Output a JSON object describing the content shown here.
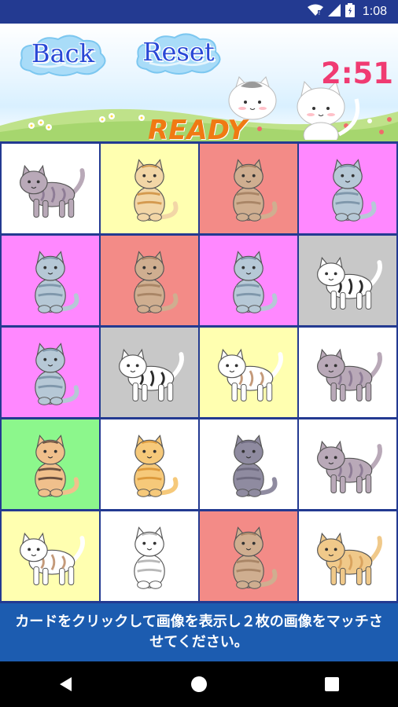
{
  "status_bar": {
    "time": "1:08",
    "icons": [
      "wifi-icon",
      "signal-icon",
      "battery-icon"
    ]
  },
  "header": {
    "back_label": "Back",
    "reset_label": "Reset",
    "timer": "2:51",
    "status": "READY"
  },
  "colors": {
    "status_bar": "#233a91",
    "grid_border": "#233a91",
    "button_text": "#2948d6",
    "timer": "#f03b72",
    "ready": "#f07a13",
    "instruction_bg": "#1c5cb0",
    "card_white": "#ffffff",
    "card_yellow": "#ffffb0",
    "card_salmon": "#f38b87",
    "card_magenta": "#ff88ff",
    "card_gray": "#c8c8c8",
    "card_green": "#8cf78c"
  },
  "cards": [
    {
      "bg": "#ffffff",
      "cat": "gray-tabby-standing-cat",
      "body": "#b9a9b8",
      "stripe": "#8e7c96"
    },
    {
      "bg": "#ffffb0",
      "cat": "orange-longhair-sitting-cat",
      "body": "#f2d6a6",
      "stripe": "#d49a4f"
    },
    {
      "bg": "#f38b87",
      "cat": "tan-sitting-cat",
      "body": "#cfae90",
      "stripe": "#a98566"
    },
    {
      "bg": "#ff88ff",
      "cat": "silver-tabby-sitting-cat",
      "body": "#b6c8d6",
      "stripe": "#7f97ab"
    },
    {
      "bg": "#ff88ff",
      "cat": "silver-tabby-sitting-cat",
      "body": "#b6c8d6",
      "stripe": "#7f97ab"
    },
    {
      "bg": "#f38b87",
      "cat": "tan-sitting-cat",
      "body": "#cfae90",
      "stripe": "#a98566"
    },
    {
      "bg": "#ff88ff",
      "cat": "silver-tabby-sitting-cat",
      "body": "#b6c8d6",
      "stripe": "#7f97ab"
    },
    {
      "bg": "#c8c8c8",
      "cat": "black-white-standing-cat",
      "body": "#ffffff",
      "stripe": "#2b2b2b"
    },
    {
      "bg": "#ff88ff",
      "cat": "silver-tabby-sitting-cat",
      "body": "#b6c8d6",
      "stripe": "#7f97ab"
    },
    {
      "bg": "#c8c8c8",
      "cat": "black-white-standing-cat",
      "body": "#ffffff",
      "stripe": "#2b2b2b"
    },
    {
      "bg": "#ffffb0",
      "cat": "calico-standing-cat",
      "body": "#ffffff",
      "stripe": "#c49a7a"
    },
    {
      "bg": "#ffffff",
      "cat": "gray-tabby-standing-cat",
      "body": "#b9a9b8",
      "stripe": "#8e7c96"
    },
    {
      "bg": "#8cf78c",
      "cat": "siamese-sitting-cat",
      "body": "#f0c08c",
      "stripe": "#6b5040"
    },
    {
      "bg": "#ffffff",
      "cat": "orange-tabby-sitting-cat",
      "body": "#f6c97a",
      "stripe": "#dd9a3c"
    },
    {
      "bg": "#ffffff",
      "cat": "gray-sitting-cat",
      "body": "#8f8ba0",
      "stripe": "#6f6b80"
    },
    {
      "bg": "#ffffff",
      "cat": "gray-tabby-standing-cat",
      "body": "#b9a9b8",
      "stripe": "#8e7c96"
    },
    {
      "bg": "#ffffb0",
      "cat": "calico-standing-cat",
      "body": "#ffffff",
      "stripe": "#c49a7a"
    },
    {
      "bg": "#ffffff",
      "cat": "white-longhair-sitting-cat",
      "body": "#ffffff",
      "stripe": "#b8b8b8"
    },
    {
      "bg": "#f38b87",
      "cat": "tan-sitting-cat",
      "body": "#cfae90",
      "stripe": "#a98566"
    },
    {
      "bg": "#ffffff",
      "cat": "cream-standing-cat",
      "body": "#f0c98a",
      "stripe": "#d9a35e"
    }
  ],
  "instruction": "カードをクリックして画像を表示し２枚の画像をマッチさせてください。",
  "nav": {
    "icons": [
      "back-triangle-icon",
      "home-circle-icon",
      "recents-square-icon"
    ]
  }
}
